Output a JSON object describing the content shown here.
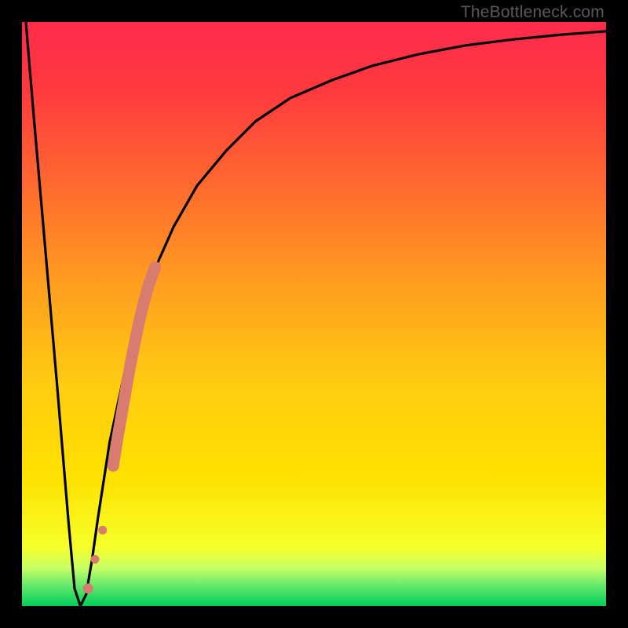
{
  "watermark": "TheBottleneck.com",
  "colors": {
    "gradient_top": "#ff2b4c",
    "gradient_yellow": "#ffe100",
    "gradient_green_band_top": "#c8ff66",
    "gradient_green_bottom": "#00cf5a",
    "curve": "#000000",
    "dots": "#d87c6f",
    "frame": "#000000"
  },
  "chart_data": {
    "type": "line",
    "title": "",
    "xlabel": "",
    "ylabel": "",
    "xlim": [
      0,
      100
    ],
    "ylim": [
      0,
      100
    ],
    "curve": {
      "x": [
        0,
        2,
        4,
        6,
        8,
        9,
        10,
        11,
        12,
        13,
        15,
        18,
        22,
        26,
        30,
        35,
        40,
        46,
        53,
        60,
        68,
        76,
        84,
        92,
        100
      ],
      "y": [
        108,
        84,
        61,
        38,
        14,
        3,
        0,
        2,
        8,
        15,
        28,
        42,
        56,
        65,
        72,
        78,
        83,
        87,
        90,
        92.5,
        94.5,
        96,
        97,
        97.8,
        98.4
      ]
    },
    "series": [
      {
        "name": "highlight-dots",
        "type": "scatter",
        "x": [
          11.3,
          12.5,
          13.8,
          15.6,
          16.4,
          17.1,
          17.8,
          18.5,
          19.2,
          19.9,
          20.6,
          21.7,
          22.8
        ],
        "y": [
          3,
          8,
          13,
          24,
          29,
          33,
          37,
          41,
          44.5,
          48,
          51,
          55,
          58
        ]
      }
    ],
    "green_band_y": [
      0,
      6
    ]
  }
}
